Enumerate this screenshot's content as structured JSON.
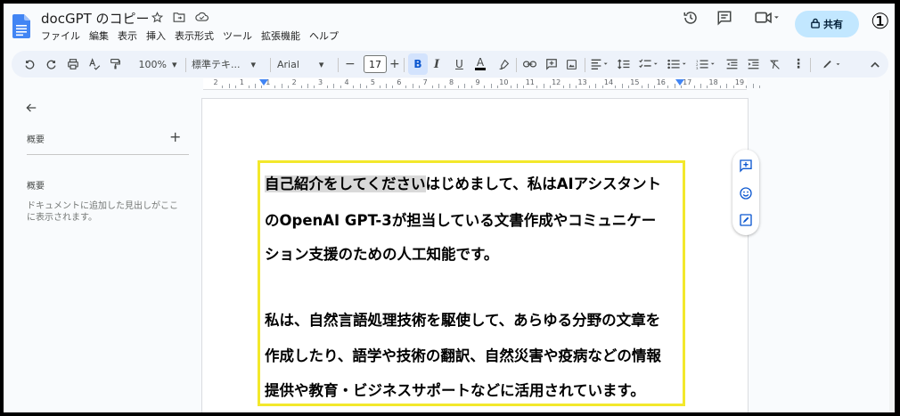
{
  "header": {
    "doc_title": "docGPT のコピー",
    "menu": [
      "ファイル",
      "編集",
      "表示",
      "挿入",
      "表示形式",
      "ツール",
      "拡張機能",
      "ヘルプ"
    ],
    "share_label": "共有",
    "annotation_number": "①"
  },
  "toolbar": {
    "zoom": "100%",
    "style": "標準テキ...",
    "font": "Arial",
    "font_size": "17",
    "bold": "B",
    "italic": "I",
    "underline": "U",
    "text_color": "A"
  },
  "ruler": {
    "numbers": [
      "2",
      "1",
      "1",
      "2",
      "3",
      "4",
      "5",
      "6",
      "7",
      "8",
      "9",
      "10",
      "11",
      "12",
      "13",
      "14",
      "15",
      "16",
      "17",
      "18",
      "19"
    ]
  },
  "sidebar": {
    "summary_heading": "概要",
    "outline_heading": "概要",
    "outline_note": "ドキュメントに追加した見出しがここに表示されます。"
  },
  "document": {
    "line1_selected": "自己紹介をしてください",
    "line1_rest": "はじめまして、私はAIアシスタント",
    "line2": "のOpenAI GPT-3が担当している文書作成やコミュニケー",
    "line3": "ション支援のための人工知能です。",
    "line4": "私は、自然言語処理技術を駆使して、あらゆる分野の文章を",
    "line5": "作成したり、語学や技術の翻訳、自然災害や疫病などの情報",
    "line6": "提供や教育・ビジネスサポートなどに活用されています。"
  },
  "colors": {
    "highlight_border": "#f3e82b",
    "share_bg": "#c2e7ff",
    "toolbar_bg": "#edf2fa",
    "selection_bg": "#d9d9d9"
  }
}
